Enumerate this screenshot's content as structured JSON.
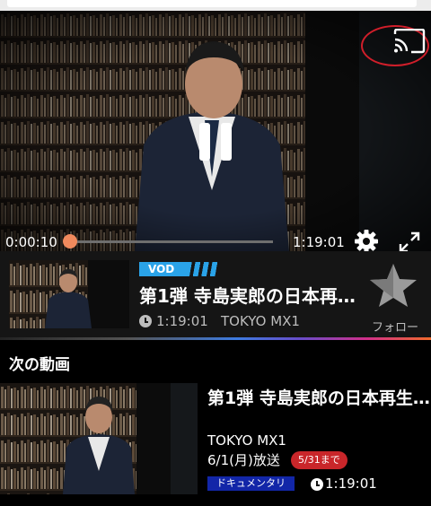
{
  "player": {
    "current_time": "0:00:10",
    "duration": "1:19:01",
    "progress": 0.002,
    "icons": [
      "cast-icon",
      "pause-icon",
      "gear-icon",
      "fullscreen-icon"
    ]
  },
  "current_program": {
    "badge": "VOD",
    "title": "第1弾 寺島実郎の日本再…",
    "duration": "1:19:01",
    "channel": "TOKYO MX1",
    "follow_label": "フォロー"
  },
  "next_section": {
    "heading": "次の動画",
    "item": {
      "title": "第1弾 寺島実郎の日本再生…",
      "channel": "TOKYO MX1",
      "air_date": "6/1(月)放送",
      "deadline": "5/31まで",
      "genre": "ドキュメンタリ",
      "duration": "1:19:01"
    }
  },
  "colors": {
    "accent_orange": "#f08a5d",
    "vod_blue": "#2aa3e8",
    "deadline_red": "#c9262a",
    "genre_navy": "#1226a8",
    "highlight_ring": "#d01e2a"
  }
}
